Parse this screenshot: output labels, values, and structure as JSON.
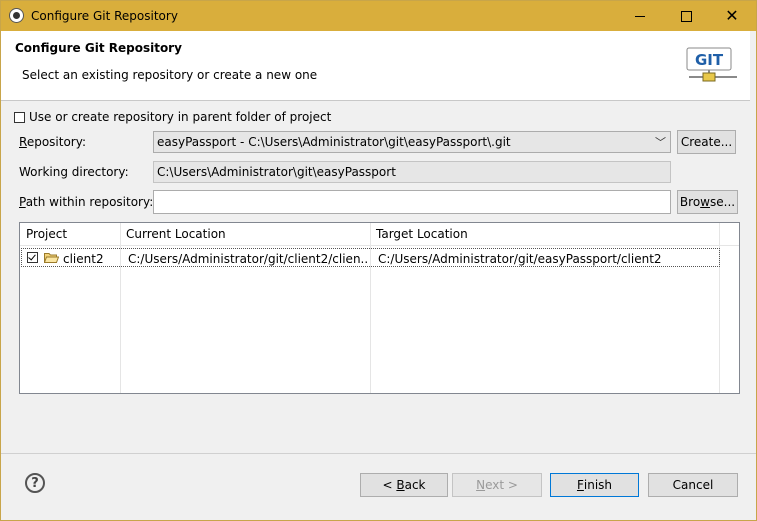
{
  "window": {
    "title": "Configure Git Repository",
    "controls": [
      "minimize-icon",
      "maximize-icon",
      "close-icon"
    ]
  },
  "header": {
    "title": "Configure Git Repository",
    "description": "Select an existing repository or create a new one",
    "logo_text": "GIT"
  },
  "form": {
    "use_parent_label": "Use or create repository in parent folder of project",
    "use_parent_checked": false,
    "repository_label_mn": "R",
    "repository_label_rest": "epository:",
    "repository_value": "easyPassport - C:\\Users\\Administrator\\git\\easyPassport\\.git",
    "create_button": "Create...",
    "working_dir_label": "Working directory:",
    "working_dir_value": "C:\\Users\\Administrator\\git\\easyPassport",
    "path_label_mn": "P",
    "path_label_rest": "ath within repository:",
    "path_value": "",
    "browse_button_pre": "Bro",
    "browse_button_mn": "w",
    "browse_button_post": "se..."
  },
  "table": {
    "columns": [
      "Project",
      "Current Location",
      "Target Location"
    ],
    "rows": [
      {
        "checked": true,
        "project": "client2",
        "current": "C:/Users/Administrator/git/client2/clien...",
        "target": "C:/Users/Administrator/git/easyPassport/client2"
      }
    ]
  },
  "footer": {
    "help": "?",
    "back_pre": "< ",
    "back_mn": "B",
    "back_post": "ack",
    "next_mn": "N",
    "next_post": "ext >",
    "finish_mn": "F",
    "finish_post": "inish",
    "cancel": "Cancel"
  },
  "colors": {
    "titlebar": "#d9ae3c",
    "accent_border": "#0078d7"
  }
}
